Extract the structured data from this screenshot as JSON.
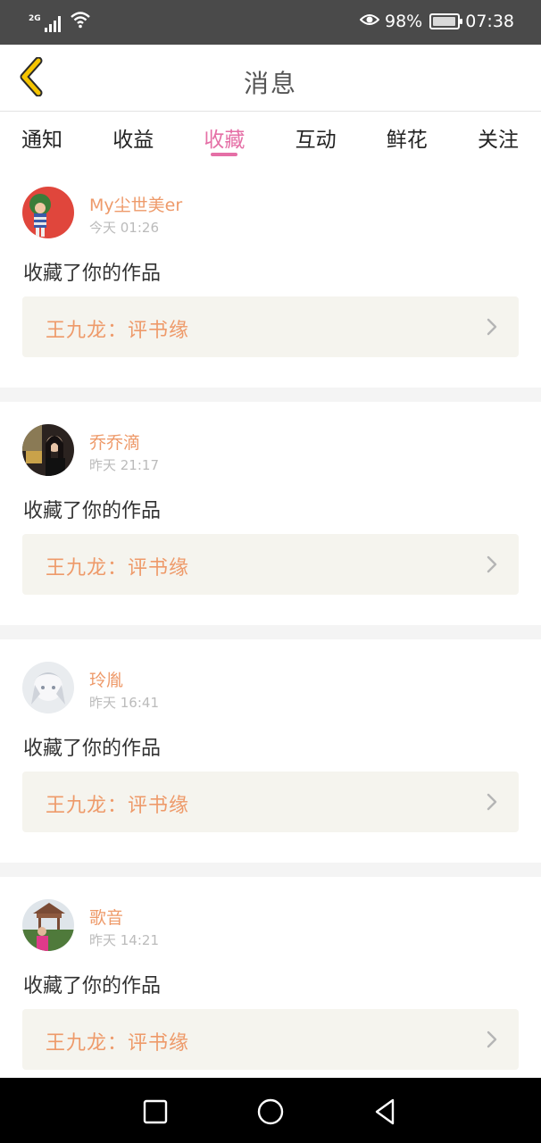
{
  "status_bar": {
    "network": "2G",
    "battery_percent": "98%",
    "time": "07:38",
    "icons": [
      "signal-icon",
      "wifi-icon",
      "eye-icon",
      "battery-icon"
    ]
  },
  "header": {
    "title": "消息",
    "back_icon": "chevron-left-icon"
  },
  "tabs": [
    {
      "label": "通知",
      "active": false
    },
    {
      "label": "收益",
      "active": false
    },
    {
      "label": "收藏",
      "active": true
    },
    {
      "label": "互动",
      "active": false
    },
    {
      "label": "鲜花",
      "active": false
    },
    {
      "label": "关注",
      "active": false
    }
  ],
  "feed": [
    {
      "username": "My尘世美er",
      "time": "今天 01:26",
      "action": "收藏了你的作品",
      "work": "王九龙：评书缘"
    },
    {
      "username": "乔乔滴",
      "time": "昨天 21:17",
      "action": "收藏了你的作品",
      "work": "王九龙：评书缘"
    },
    {
      "username": "玲胤",
      "time": "昨天 16:41",
      "action": "收藏了你的作品",
      "work": "王九龙：评书缘"
    },
    {
      "username": "歌音",
      "time": "昨天 14:21",
      "action": "收藏了你的作品",
      "work": "王九龙：评书缘"
    }
  ],
  "nav_bar": {
    "icons": [
      "square-recents-icon",
      "circle-home-icon",
      "triangle-back-icon"
    ]
  },
  "colors": {
    "accent_pink": "#e56fa6",
    "name_orange": "#ee9a6a",
    "back_arrow_yellow": "#f5c400",
    "work_box_bg": "#f5f4ee",
    "status_bar_bg": "#4a4a4a"
  }
}
